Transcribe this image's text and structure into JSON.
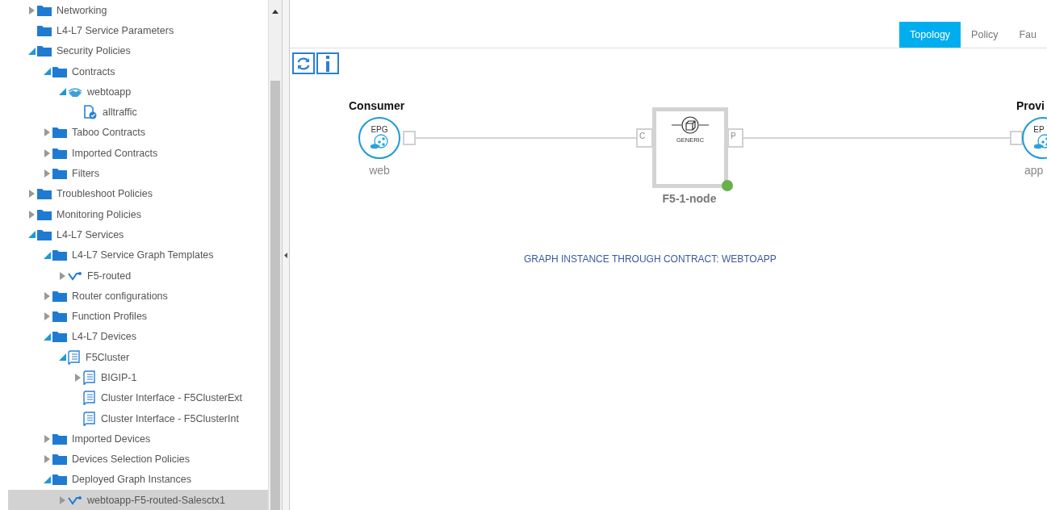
{
  "tree": [
    {
      "label": "Networking",
      "kind": "folder",
      "expanded": false,
      "selected": false
    },
    {
      "label": "L4-L7 Service Parameters",
      "kind": "folder",
      "selected": false
    },
    {
      "label": "Security Policies",
      "kind": "folder",
      "expanded": true,
      "selected": false,
      "children": [
        {
          "label": "Contracts",
          "kind": "folder",
          "expanded": true,
          "selected": false,
          "children": [
            {
              "label": "webtoapp",
              "kind": "contract",
              "expanded": true,
              "selected": false,
              "children": [
                {
                  "label": "alltraffic",
                  "kind": "subject",
                  "selected": false
                }
              ]
            }
          ]
        },
        {
          "label": "Taboo Contracts",
          "kind": "folder",
          "expanded": false,
          "selected": false
        },
        {
          "label": "Imported Contracts",
          "kind": "folder",
          "expanded": false,
          "selected": false
        },
        {
          "label": "Filters",
          "kind": "folder",
          "expanded": false,
          "selected": false
        }
      ]
    },
    {
      "label": "Troubleshoot Policies",
      "kind": "folder",
      "expanded": false,
      "selected": false
    },
    {
      "label": "Monitoring Policies",
      "kind": "folder",
      "expanded": false,
      "selected": false
    },
    {
      "label": "L4-L7 Services",
      "kind": "folder",
      "expanded": true,
      "selected": false,
      "children": [
        {
          "label": "L4-L7 Service Graph Templates",
          "kind": "folder",
          "expanded": true,
          "selected": false,
          "children": [
            {
              "label": "F5-routed",
              "kind": "graph",
              "expanded": false,
              "selected": false
            }
          ]
        },
        {
          "label": "Router configurations",
          "kind": "folder",
          "expanded": false,
          "selected": false
        },
        {
          "label": "Function Profiles",
          "kind": "folder",
          "expanded": false,
          "selected": false
        },
        {
          "label": "L4-L7 Devices",
          "kind": "folder",
          "expanded": true,
          "selected": false,
          "children": [
            {
              "label": "F5Cluster",
              "kind": "device",
              "expanded": true,
              "selected": false,
              "children": [
                {
                  "label": "BIGIP-1",
                  "kind": "device",
                  "expanded": false,
                  "selected": false
                },
                {
                  "label": "Cluster Interface - F5ClusterExt",
                  "kind": "device",
                  "selected": false
                },
                {
                  "label": "Cluster Interface - F5ClusterInt",
                  "kind": "device",
                  "selected": false
                }
              ]
            }
          ]
        },
        {
          "label": "Imported Devices",
          "kind": "folder",
          "expanded": false,
          "selected": false
        },
        {
          "label": "Devices Selection Policies",
          "kind": "folder",
          "expanded": false,
          "selected": false
        },
        {
          "label": "Deployed Graph Instances",
          "kind": "folder",
          "expanded": true,
          "selected": false,
          "children": [
            {
              "label": "webtoapp-F5-routed-Salesctx1",
              "kind": "graph",
              "expanded": false,
              "selected": true
            }
          ]
        }
      ]
    }
  ],
  "tabs": [
    {
      "label": "Topology",
      "selected": true
    },
    {
      "label": "Policy",
      "selected": false
    },
    {
      "label": "Fau",
      "selected": false
    }
  ],
  "graph": {
    "consumer": {
      "role": "Consumer",
      "badge": "EPG",
      "name": "web"
    },
    "node": {
      "name": "F5-1-node",
      "type": "GENERIC",
      "consumer_port": "C",
      "provider_port": "P"
    },
    "provider": {
      "role": "Provi",
      "badge": "EP",
      "name": "app"
    },
    "caption": "GRAPH INSTANCE THROUGH CONTRACT: WEBTOAPP"
  }
}
